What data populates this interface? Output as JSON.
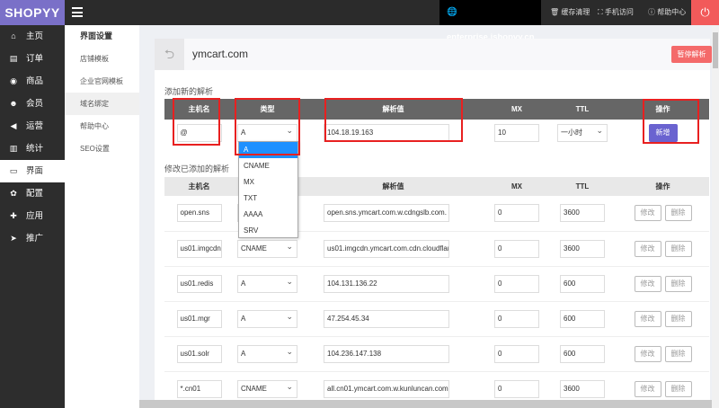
{
  "topbar": {
    "logo": "SHOPYY",
    "site": "enterprise.ishopyy.cn",
    "cache": "缓存清理",
    "mobile": "手机访问",
    "help": "帮助中心"
  },
  "sidebar": {
    "items": [
      {
        "label": "主页",
        "icon": "⌂"
      },
      {
        "label": "订单",
        "icon": "▤"
      },
      {
        "label": "商品",
        "icon": "◉"
      },
      {
        "label": "会员",
        "icon": "☻"
      },
      {
        "label": "运营",
        "icon": "◀"
      },
      {
        "label": "统计",
        "icon": "▥"
      },
      {
        "label": "界面",
        "icon": "▭"
      },
      {
        "label": "配置",
        "icon": "✿"
      },
      {
        "label": "应用",
        "icon": "✚"
      },
      {
        "label": "推广",
        "icon": "➤"
      }
    ]
  },
  "subnav": {
    "heading": "界面设置",
    "items": [
      "店铺模板",
      "企业官网模板",
      "域名绑定",
      "帮助中心",
      "SEO设置"
    ]
  },
  "card": {
    "domain": "ymcart.com",
    "pause": "暂停解析"
  },
  "add": {
    "title": "添加新的解析",
    "headers": [
      "主机名",
      "类型",
      "解析值",
      "MX",
      "TTL",
      "操作"
    ],
    "host": "@",
    "type": "A",
    "value": "104.18.19.163",
    "mx": "10",
    "ttl": "一小时",
    "button": "新增"
  },
  "dropdown": {
    "options": [
      "A",
      "CNAME",
      "MX",
      "TXT",
      "AAAA",
      "SRV"
    ]
  },
  "edit": {
    "title": "修改已添加的解析",
    "headers": [
      "主机名",
      "类型",
      "解析值",
      "MX",
      "TTL",
      "操作"
    ],
    "edit_label": "修改",
    "delete_label": "删除",
    "rows": [
      {
        "host": "open.sns",
        "type": "CNAME",
        "value": "open.sns.ymcart.com.w.cdngslb.com.",
        "mx": "0",
        "ttl": "3600"
      },
      {
        "host": "us01.imgcdn",
        "type": "CNAME",
        "value": "us01.imgcdn.ymcart.com.cdn.cloudflare",
        "mx": "0",
        "ttl": "3600"
      },
      {
        "host": "us01.redis",
        "type": "A",
        "value": "104.131.136.22",
        "mx": "0",
        "ttl": "600"
      },
      {
        "host": "us01.mgr",
        "type": "A",
        "value": "47.254.45.34",
        "mx": "0",
        "ttl": "600"
      },
      {
        "host": "us01.solr",
        "type": "A",
        "value": "104.236.147.138",
        "mx": "0",
        "ttl": "600"
      },
      {
        "host": "*.cn01",
        "type": "CNAME",
        "value": "all.cn01.ymcart.com.w.kunluncan.com.",
        "mx": "0",
        "ttl": "3600"
      }
    ]
  }
}
